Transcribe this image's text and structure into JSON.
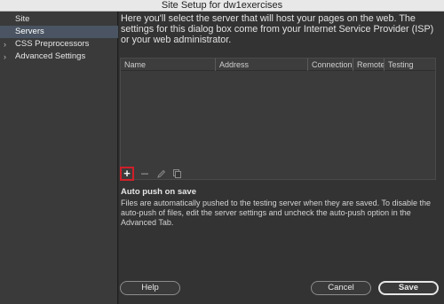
{
  "window": {
    "title": "Site Setup for dw1exercises"
  },
  "sidebar": {
    "items": [
      {
        "label": "Site",
        "selected": false,
        "expandable": false
      },
      {
        "label": "Servers",
        "selected": true,
        "expandable": false
      },
      {
        "label": "CSS Preprocessors",
        "selected": false,
        "expandable": true
      },
      {
        "label": "Advanced Settings",
        "selected": false,
        "expandable": true
      }
    ]
  },
  "main": {
    "intro": "Here you'll select the server that will host your pages on the web. The settings for this dialog box come from your Internet Service Provider (ISP) or your web administrator.",
    "table": {
      "columns": [
        "Name",
        "Address",
        "Connection",
        "Remote",
        "Testing"
      ],
      "rows": []
    },
    "toolbar": {
      "add": "+",
      "remove": "remove-server",
      "edit": "edit-server",
      "duplicate": "duplicate-server"
    },
    "auto_push": {
      "title": "Auto push on save",
      "description": "Files are automatically pushed to the testing server when they are saved. To disable the auto-push of files, edit the server settings and uncheck the auto-push option in the Advanced Tab."
    }
  },
  "footer": {
    "help_label": "Help",
    "cancel_label": "Cancel",
    "save_label": "Save"
  },
  "colors": {
    "sidebar_selected": "#4a5462",
    "highlight_border": "#d0202a",
    "background": "#333333"
  }
}
